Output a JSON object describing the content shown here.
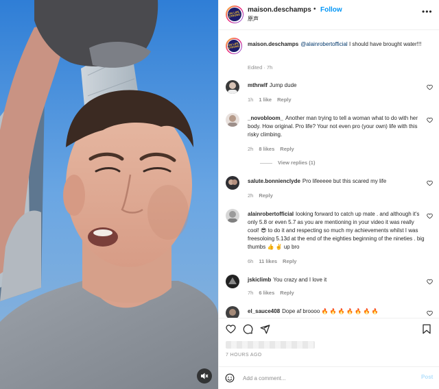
{
  "header": {
    "username": "maison.deschamps",
    "separator": "•",
    "follow_label": "Follow",
    "subtitle": "原声",
    "more_icon": "more-horizontal-icon",
    "avatar_text": "ON LIFE\nSTRONG"
  },
  "caption": {
    "username": "maison.deschamps",
    "mention": "@alainrobertofficial",
    "text": "I should have brought water!!!",
    "meta": "Edited · 7h"
  },
  "comments": [
    {
      "username": "mthrwlf",
      "text": "Jump dude",
      "time": "1h",
      "likes": "1 like",
      "reply": "Reply"
    },
    {
      "username": "_novobloom_",
      "text": "Another man trying to tell a woman what to do with her body. How original. Pro life? Your not even pro (your own) life with this risky climbing.",
      "time": "2h",
      "likes": "8 likes",
      "reply": "Reply",
      "view_replies": "View replies (1)"
    },
    {
      "username": "salute.bonnienclyde",
      "text": "Pro lifeeeee but this scared my life",
      "time": "2h",
      "reply": "Reply"
    },
    {
      "username": "alainrobertofficial",
      "text": "looking forward to catch up mate . and although it's only 5.8 or even 5.7 as you are mentioning in your video it was really cool! 😎 to do it and respecting so much my achievements whilst I was freesoloing 5.13d at the end of the eighties beginning of the nineties . big thumbs 👍 ✌️ up bro",
      "time": "6h",
      "likes": "11 likes",
      "reply": "Reply"
    },
    {
      "username": "jskiclimb",
      "text": "You crazy and I love it",
      "time": "7h",
      "likes": "6 likes",
      "reply": "Reply"
    },
    {
      "username": "el_sauce408",
      "text": "Dope af broooo 🔥 🔥 🔥 🔥 🔥 🔥 🔥",
      "time": "",
      "reply": ""
    }
  ],
  "actions": {
    "like_icon": "heart-icon",
    "comment_icon": "comment-icon",
    "share_icon": "send-icon",
    "save_icon": "bookmark-icon"
  },
  "timestamp": "7 HOURS AGO",
  "add_comment": {
    "placeholder": "Add a comment...",
    "post_label": "Post",
    "emoji_icon": "smiley-icon"
  },
  "media": {
    "mute_icon": "speaker-muted-icon"
  },
  "colors": {
    "link": "#0095f6",
    "mention": "#00376b",
    "muted_text": "#8e8e8e",
    "post_disabled": "#b2dffc"
  }
}
